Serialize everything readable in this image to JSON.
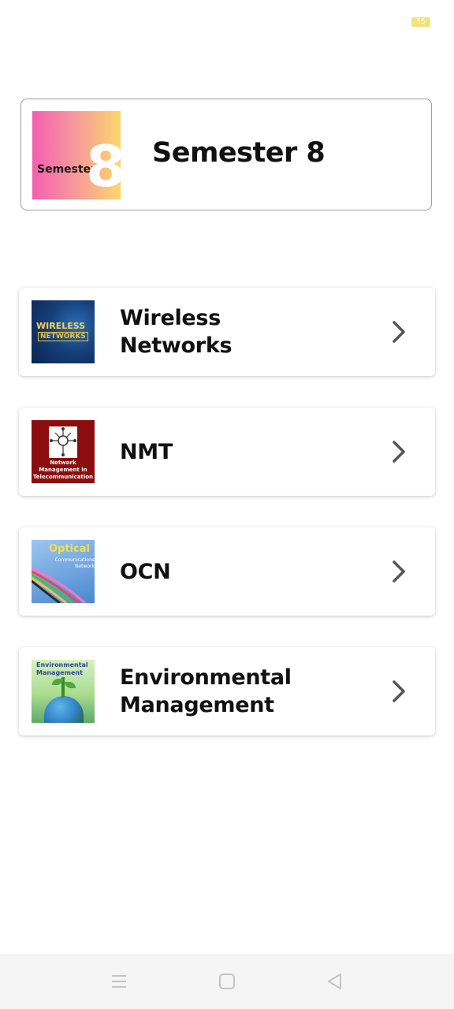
{
  "status_bar": {
    "battery_level": "55",
    "battery_color": "#f3e27a"
  },
  "semester": {
    "thumb_word": "Semester",
    "thumb_number": "8",
    "title": "Semester 8"
  },
  "subjects": [
    {
      "name": "Wireless\nNetworks",
      "thumb_text_1": "WIRELESS",
      "thumb_text_2": "NETWORKS",
      "icon": "chevron-right-icon"
    },
    {
      "name": "NMT",
      "thumb_caption": "Network Management in Telecommunication",
      "icon": "chevron-right-icon"
    },
    {
      "name": "OCN",
      "thumb_text_1": "Optical",
      "thumb_text_2": "Communications Network",
      "icon": "chevron-right-icon"
    },
    {
      "name": "Environmental\nManagement",
      "thumb_text_1": "Environmental Management",
      "icon": "chevron-right-icon"
    }
  ],
  "navbar": {
    "menu_icon": "menu-icon",
    "home_icon": "home-square-icon",
    "back_icon": "back-triangle-icon"
  },
  "colors": {
    "chevron": "#555555",
    "nav_icon": "#c4c4c4"
  }
}
